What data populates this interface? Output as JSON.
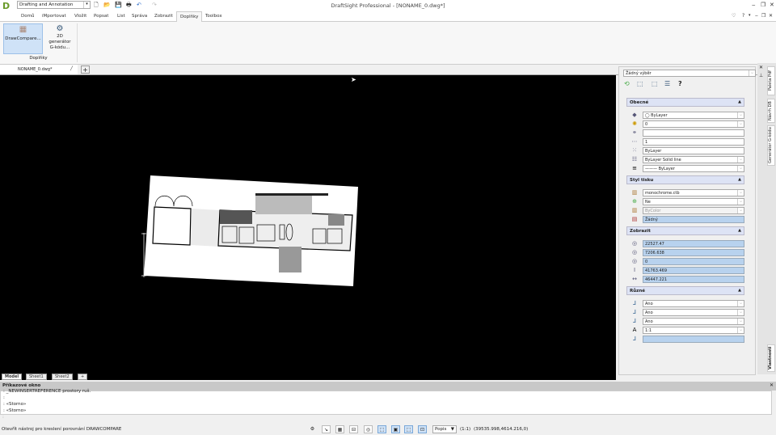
{
  "app": {
    "title": "DraftSight Professional - [NONAME_0.dwg*]",
    "workspace": "Drafting and Annotation"
  },
  "ribbon": {
    "tabs": [
      "Domů",
      "iMportovat",
      "Vložit",
      "Popsat",
      "List",
      "Správa",
      "Zobrazit",
      "Doplňky",
      "Toolbox"
    ],
    "active_tab": "Doplňky",
    "buttons": [
      {
        "label": "DrawCompare...",
        "icon": "drawcompare-icon"
      },
      {
        "label": "2D generátor G-kódu...",
        "icon": "gear-icon"
      }
    ],
    "group": "Doplňky"
  },
  "document": {
    "tab": "NONAME_0.dwg*"
  },
  "sheets": [
    "Model",
    "Sheet1",
    "Sheet2"
  ],
  "properties": {
    "selection": "Žádný výběr",
    "general": {
      "title": "Obecné",
      "color": "◯ ByLayer",
      "layer": "0",
      "link": "",
      "scale": "1",
      "linetype": "ByLayer",
      "linestyle": "ByLayer     Solid line",
      "lineweight": "——— ByLayer"
    },
    "print_style": {
      "title": "Styl tisku",
      "table": "monochrome.ctb",
      "attached": "Ne",
      "style": "ByColor",
      "none": "Žádný"
    },
    "view": {
      "title": "Zobrazit",
      "center_x": "22527.47",
      "center_y": "7206.638",
      "center_z": "0",
      "height": "41763.469",
      "width": "46447.221"
    },
    "misc": {
      "title": "Různé",
      "ucs_icon": "Ano",
      "ucs_origin": "Ano",
      "ucs_per_viewport": "Ano",
      "annotation_scale": "1:1",
      "ucs_name": ""
    }
  },
  "side_tabs": [
    "Paleta Pdf",
    "Návrh DB",
    "Generátor G-kódu",
    "Vlastnosti"
  ],
  "command": {
    "title": "Příkazové okno",
    "lines": [
      ": _NEWINSERTREFERENCE prostory ruš.",
      ":",
      ": «Storno»",
      ": «Storno»"
    ],
    "prompt": ":"
  },
  "status": {
    "hint": "Otevřít nástroj pro kreslení porovnání DRAWCOMPARE",
    "annotation": "Popis",
    "scale": "(1:1)",
    "coords": "(39535.998,4614.216,0)"
  }
}
